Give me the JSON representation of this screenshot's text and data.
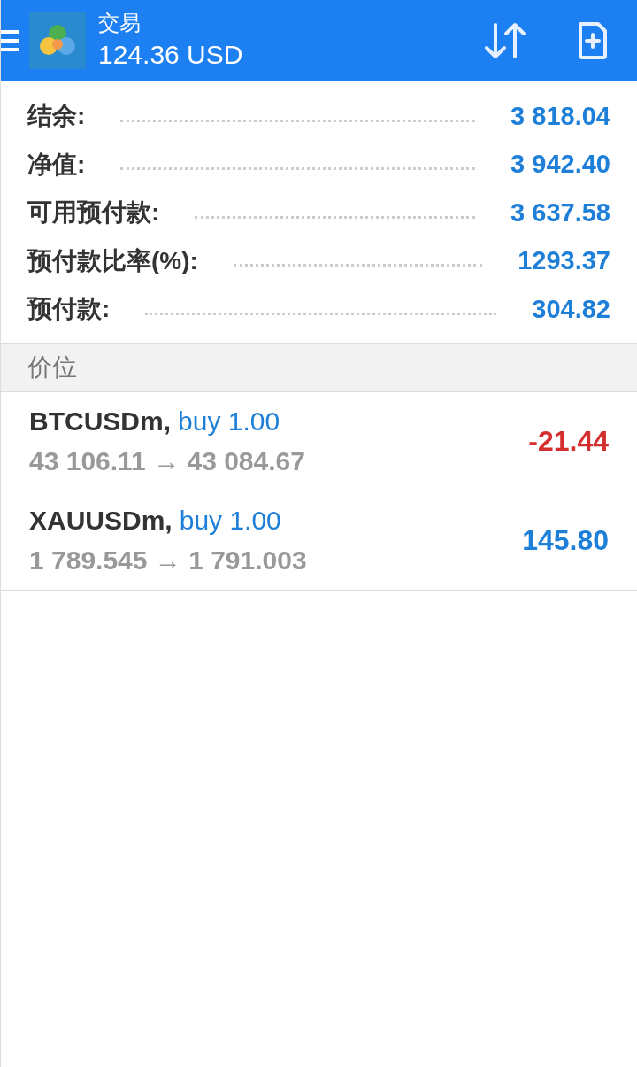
{
  "header": {
    "title": "交易",
    "balance": "124.36 USD"
  },
  "summary": [
    {
      "label": "结余:",
      "value": "3 818.04"
    },
    {
      "label": "净值:",
      "value": "3 942.40"
    },
    {
      "label": "可用预付款:",
      "value": "3 637.58"
    },
    {
      "label": "预付款比率(%):",
      "value": "1293.37"
    },
    {
      "label": "预付款:",
      "value": "304.82"
    }
  ],
  "section": {
    "title": "价位"
  },
  "positions": [
    {
      "symbol": "BTCUSDm,",
      "order": "buy 1.00",
      "prices": "43 106.11 → 43 084.67",
      "profit": "-21.44",
      "color": "#d32f2f"
    },
    {
      "symbol": "XAUUSDm,",
      "order": "buy 1.00",
      "prices": "1 789.545 → 1 791.003",
      "profit": "145.80",
      "color": "#1e7fd8"
    }
  ]
}
